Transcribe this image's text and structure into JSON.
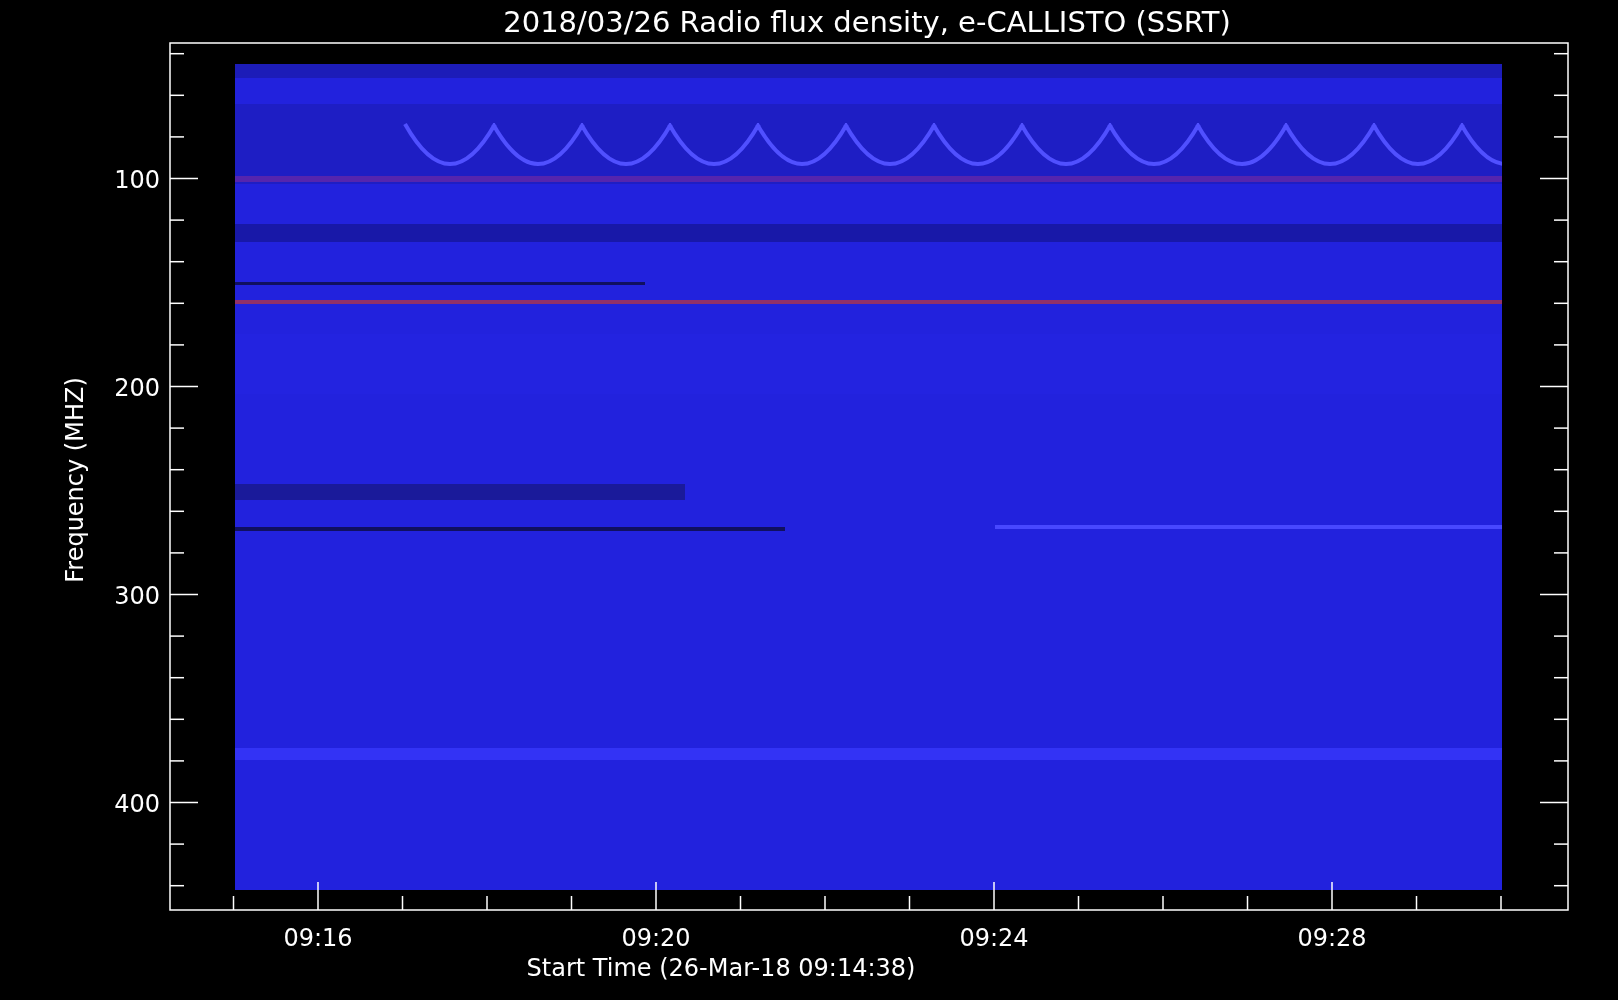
{
  "title": "2018/03/26  Radio flux density, e-CALLISTO (SSRT)",
  "y_axis": {
    "label": "Frequency (MHZ)",
    "tick_labels": [
      "100",
      "200",
      "300",
      "400"
    ]
  },
  "x_axis": {
    "label": "Start Time (26-Mar-18 09:14:38)",
    "tick_labels": [
      "09:16",
      "09:20",
      "09:24",
      "09:28"
    ]
  }
}
